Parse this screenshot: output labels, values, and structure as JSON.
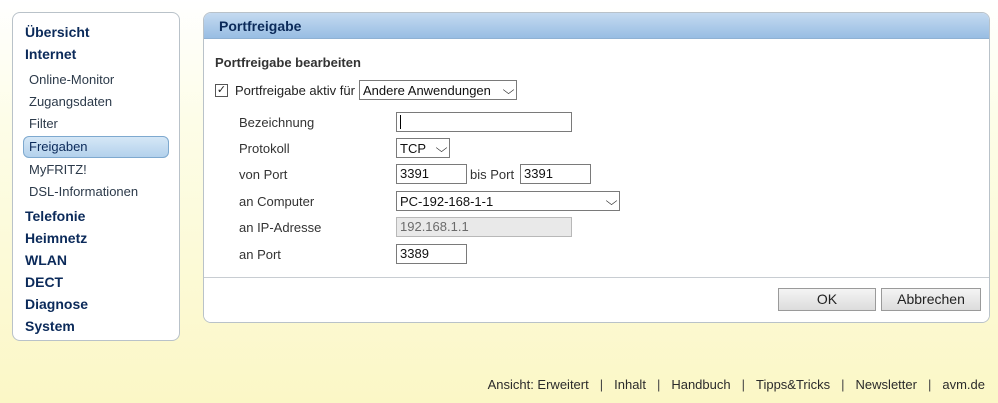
{
  "sidebar": {
    "items": [
      {
        "label": "Übersicht",
        "level": "top"
      },
      {
        "label": "Internet",
        "level": "top"
      },
      {
        "label": "Online-Monitor",
        "level": "sub"
      },
      {
        "label": "Zugangsdaten",
        "level": "sub"
      },
      {
        "label": "Filter",
        "level": "sub"
      },
      {
        "label": "Freigaben",
        "level": "sub",
        "active": true
      },
      {
        "label": "MyFRITZ!",
        "level": "sub"
      },
      {
        "label": "DSL-Informationen",
        "level": "sub"
      },
      {
        "label": "Telefonie",
        "level": "top"
      },
      {
        "label": "Heimnetz",
        "level": "top"
      },
      {
        "label": "WLAN",
        "level": "top"
      },
      {
        "label": "DECT",
        "level": "top"
      },
      {
        "label": "Diagnose",
        "level": "top"
      },
      {
        "label": "System",
        "level": "top"
      }
    ]
  },
  "panel": {
    "title": "Portfreigabe",
    "section_title": "Portfreigabe bearbeiten",
    "enable": {
      "checked": true,
      "checkmark": "✓",
      "label": "Portfreigabe aktiv für",
      "selected": "Andere Anwendungen"
    },
    "fields": {
      "bezeichnung": {
        "label": "Bezeichnung",
        "value": ""
      },
      "protokoll": {
        "label": "Protokoll",
        "value": "TCP"
      },
      "von_port": {
        "label": "von Port",
        "value": "3391"
      },
      "bis_port": {
        "label": "bis Port",
        "value": "3391"
      },
      "an_computer": {
        "label": "an Computer",
        "value": "PC-192-168-1-1"
      },
      "an_ip": {
        "label": "an IP-Adresse",
        "value": "192.168.1.1"
      },
      "an_port": {
        "label": "an Port",
        "value": "3389"
      }
    },
    "buttons": {
      "ok": "OK",
      "cancel": "Abbrechen"
    }
  },
  "footer": {
    "links": [
      "Ansicht: Erweitert",
      "Inhalt",
      "Handbuch",
      "Tipps&Tricks",
      "Newsletter",
      "avm.de"
    ],
    "separator": "|"
  },
  "icons": {
    "chevron": "chevron-down-icon",
    "checkbox": "checkmark-icon"
  },
  "colors": {
    "header_gradient_top": "#c4daf0",
    "header_gradient_bottom": "#98bde3",
    "nav_text": "#0b2a5a",
    "active_item": "#b3d1ec"
  }
}
